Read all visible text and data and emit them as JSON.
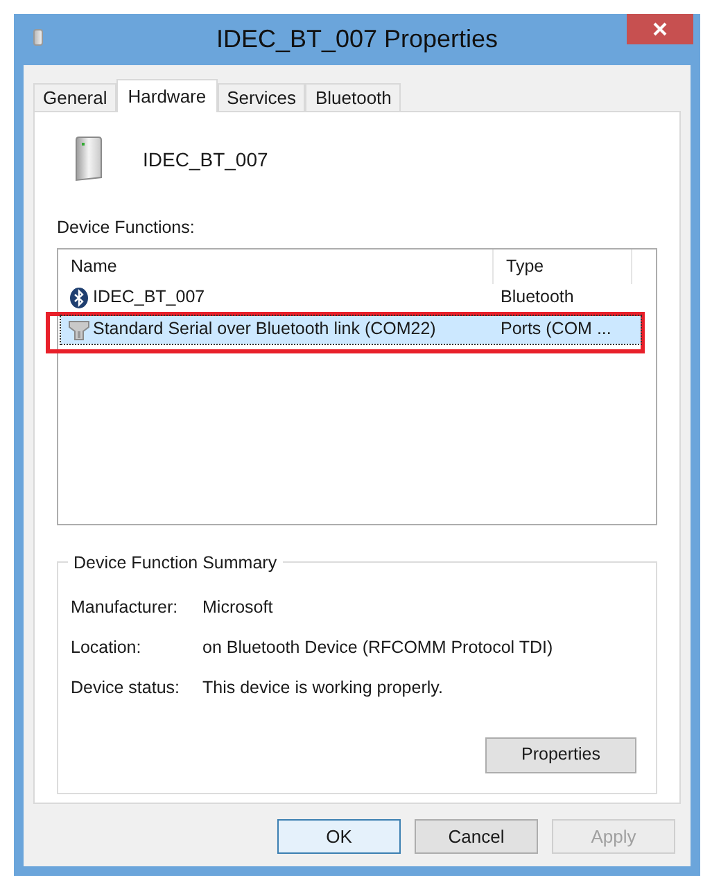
{
  "window": {
    "title": "IDEC_BT_007 Properties"
  },
  "tabs": [
    {
      "label": "General",
      "selected": false
    },
    {
      "label": "Hardware",
      "selected": true
    },
    {
      "label": "Services",
      "selected": false
    },
    {
      "label": "Bluetooth",
      "selected": false
    }
  ],
  "device": {
    "name": "IDEC_BT_007"
  },
  "functions": {
    "label": "Device Functions:",
    "columns": [
      "Name",
      "Type"
    ],
    "rows": [
      {
        "kind": "bluetooth",
        "name": "IDEC_BT_007",
        "type": "Bluetooth",
        "selected": false,
        "highlighted": false
      },
      {
        "kind": "port",
        "name": "Standard Serial over Bluetooth link (COM22)",
        "type": "Ports (COM ...",
        "selected": true,
        "highlighted": true
      }
    ]
  },
  "summary": {
    "title": "Device Function Summary",
    "fields": [
      {
        "label": "Manufacturer:",
        "value": "Microsoft"
      },
      {
        "label": "Location:",
        "value": "on Bluetooth Device (RFCOMM Protocol TDI)"
      },
      {
        "label": "Device status:",
        "value": "This device is working properly."
      }
    ],
    "button": "Properties"
  },
  "buttons": [
    {
      "label": "OK",
      "kind": "default",
      "disabled": false
    },
    {
      "label": "Cancel",
      "kind": "normal",
      "disabled": false
    },
    {
      "label": "Apply",
      "kind": "normal",
      "disabled": true
    }
  ]
}
